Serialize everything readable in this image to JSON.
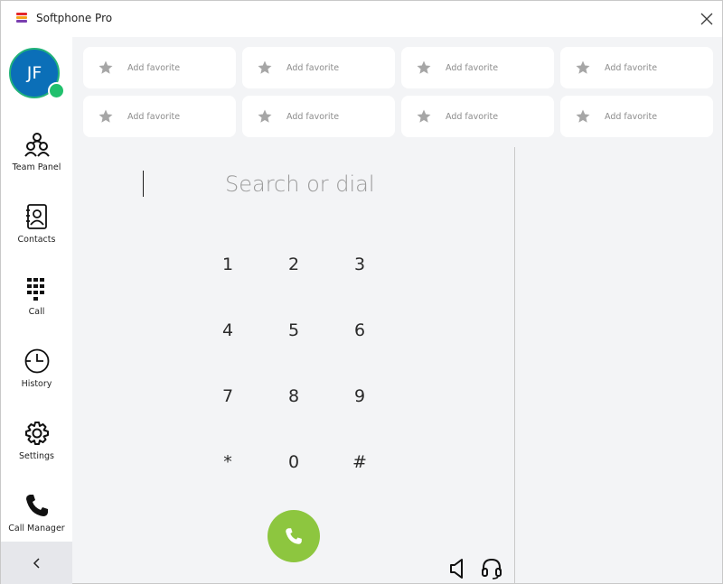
{
  "app": {
    "title": "Softphone Pro",
    "logo_colors": [
      "#e4262c",
      "#f6a21b",
      "#7a3fb0"
    ]
  },
  "user": {
    "initials": "JF",
    "presence": "online",
    "avatar_color": "#0b6fb8",
    "presence_color": "#21c06d"
  },
  "sidebar": {
    "items": [
      {
        "label": "Team Panel",
        "icon": "team-panel-icon"
      },
      {
        "label": "Contacts",
        "icon": "contacts-icon"
      },
      {
        "label": "Call",
        "icon": "dialpad-icon"
      },
      {
        "label": "History",
        "icon": "history-icon"
      },
      {
        "label": "Settings",
        "icon": "gear-icon"
      },
      {
        "label": "Call Manager",
        "icon": "phone-icon"
      }
    ],
    "collapse_icon": "chevron-left-icon"
  },
  "favorites": [
    {
      "label": "Add favorite",
      "icon": "star-icon"
    },
    {
      "label": "Add favorite",
      "icon": "star-icon"
    },
    {
      "label": "Add favorite",
      "icon": "star-icon"
    },
    {
      "label": "Add favorite",
      "icon": "star-icon"
    },
    {
      "label": "Add favorite",
      "icon": "star-icon"
    },
    {
      "label": "Add favorite",
      "icon": "star-icon"
    },
    {
      "label": "Add favorite",
      "icon": "star-icon"
    },
    {
      "label": "Add favorite",
      "icon": "star-icon"
    }
  ],
  "dialer": {
    "search_placeholder": "Search or dial",
    "search_value": "",
    "keys": [
      "1",
      "2",
      "3",
      "4",
      "5",
      "6",
      "7",
      "8",
      "9",
      "*",
      "0",
      "#"
    ],
    "call_button_color": "#8dc63f"
  },
  "audio": {
    "speaker_icon": "speaker-icon",
    "headset_icon": "headset-icon"
  }
}
